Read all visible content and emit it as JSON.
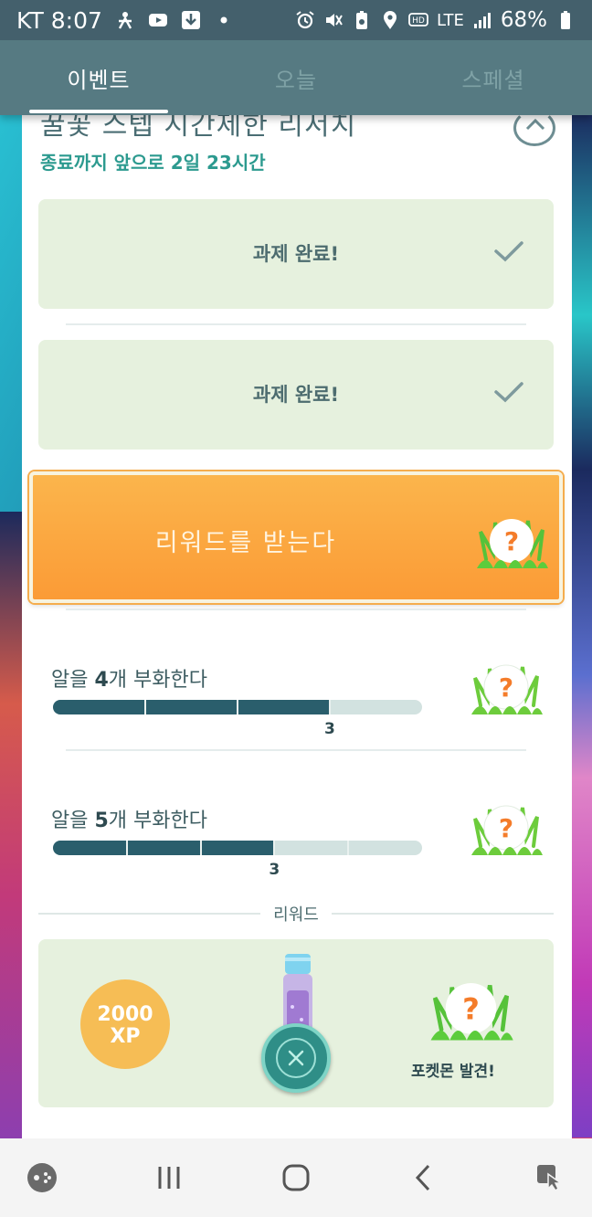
{
  "status_bar": {
    "carrier": "KT",
    "time": "8:07",
    "network": "LTE",
    "battery": "68%",
    "icons": [
      "accessibility-icon",
      "youtube-icon",
      "download-icon",
      "dot-icon",
      "alarm-icon",
      "mute-icon",
      "battery-saver-icon",
      "location-icon",
      "hd-icon",
      "lte-icon",
      "signal-icon",
      "battery-icon"
    ]
  },
  "tabs": [
    {
      "label": "이벤트",
      "active": true
    },
    {
      "label": "오늘",
      "active": false
    },
    {
      "label": "스페셜",
      "active": false
    }
  ],
  "research": {
    "title": "꿀꽃 스텝 시간제한 리서치",
    "subtitle": "종료까지 앞으로 2일 23시간",
    "completed_tasks": [
      {
        "label": "과제 완료!"
      },
      {
        "label": "과제 완료!"
      }
    ],
    "reward_button_label": "리워드를 받는다",
    "tasks": [
      {
        "prefix": "알을 ",
        "count": "4",
        "suffix": "개 부화한다",
        "progress": 3,
        "total": 4,
        "progress_label": "3"
      },
      {
        "prefix": "알을 ",
        "count": "5",
        "suffix": "개 부화한다",
        "progress": 3,
        "total": 5,
        "progress_label": "3"
      }
    ],
    "rewards_heading": "리워드",
    "rewards": {
      "xp_value": "2000",
      "xp_unit": "XP",
      "pokemon_label": "포켓몬 발견!"
    }
  },
  "colors": {
    "status_bar": "#44606c",
    "tab_bar": "#567a82",
    "accent_teal": "#2c9a8f",
    "reward_orange": "#fb9b36",
    "done_bg": "#e6f1de",
    "progress_fill": "#2a5e6c"
  }
}
